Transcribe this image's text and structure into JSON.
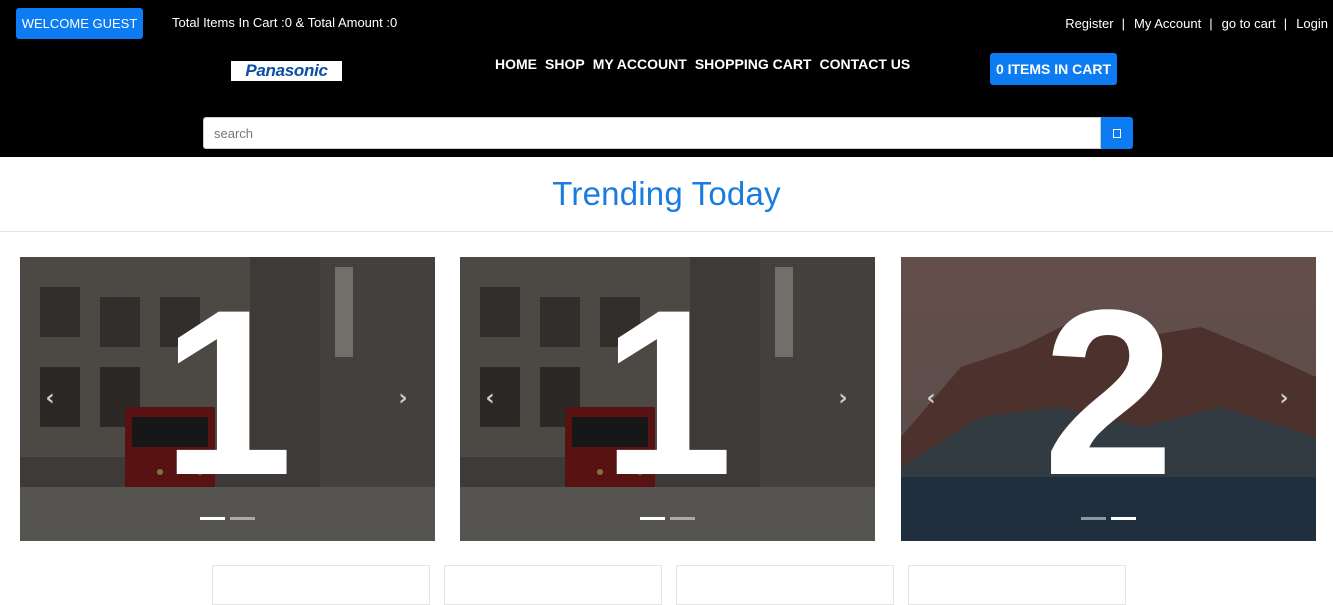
{
  "header": {
    "welcome_label": "WELCOME GUEST",
    "cart_summary": "Total Items In Cart :0 & Total Amount :0",
    "account_links": [
      "Register",
      "My Account",
      "go to cart",
      "Login"
    ],
    "separator": "|",
    "brand": "Panasonic",
    "nav": [
      "HOME",
      "SHOP",
      "MY ACCOUNT",
      "SHOPPING CART",
      "CONTACT US"
    ],
    "cart_button": "0 ITEMS IN CART"
  },
  "search": {
    "placeholder": "search",
    "button_icon": "search-icon"
  },
  "section": {
    "title": "Trending Today"
  },
  "carousels": [
    {
      "slide_number": "1",
      "active_indicator": 0,
      "indicator_count": 2,
      "scene": "tram-street"
    },
    {
      "slide_number": "1",
      "active_indicator": 0,
      "indicator_count": 2,
      "scene": "tram-street"
    },
    {
      "slide_number": "2",
      "active_indicator": 1,
      "indicator_count": 2,
      "scene": "mountains"
    }
  ],
  "arrows": {
    "prev": "‹",
    "next": "›"
  },
  "colors": {
    "accent": "#0d7cf2",
    "title": "#1b7be0",
    "header_bg": "#000000"
  }
}
